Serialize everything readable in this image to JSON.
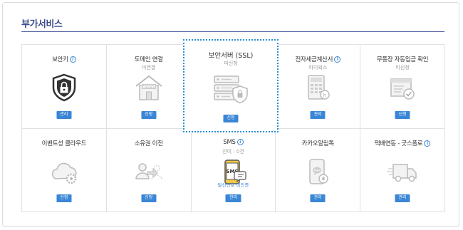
{
  "title": "부가서비스",
  "colors": {
    "accent": "#3a86d6",
    "title": "#3b4a8a",
    "border": "#e1e1e1",
    "highlight": "#2a8fd4"
  },
  "cells": [
    {
      "label": "보안키",
      "info": true,
      "sub": "",
      "button": "관리",
      "icon": "lock-shield-icon"
    },
    {
      "label": "도메인 연결",
      "info": false,
      "sub": "미연결",
      "button": "신청",
      "icon": "www-house-icon"
    },
    {
      "label": "보안서버 (SSL)",
      "info": false,
      "sub": "미신청",
      "button": "신청",
      "icon": "server-shield-icon"
    },
    {
      "label": "전자세금계산서",
      "info": true,
      "sub": "하이웍스",
      "button": "관리",
      "icon": "calculator-icon"
    },
    {
      "label": "무통장 자동입금 확인",
      "info": false,
      "sub": "미신청",
      "button": "신청",
      "icon": "deposit-check-icon"
    },
    {
      "label": "이벤트성 클라우드",
      "info": false,
      "sub": "",
      "button": "신청",
      "icon": "cloud-gear-icon"
    },
    {
      "label": "소유권 이전",
      "info": false,
      "sub": "",
      "button": "신청",
      "icon": "ownership-transfer-icon"
    },
    {
      "label": "SMS",
      "info": true,
      "sub": "잔여 : 0건",
      "note": "발신번호 미인증",
      "button": "관리",
      "icon": "sms-phone-icon"
    },
    {
      "label": "카카오알림톡",
      "info": false,
      "sub": "",
      "button": "관리",
      "icon": "kakao-phone-icon"
    },
    {
      "label": "택배연동 - 굿스플로",
      "info": true,
      "sub": "",
      "button": "관리",
      "icon": "truck-icon"
    }
  ]
}
